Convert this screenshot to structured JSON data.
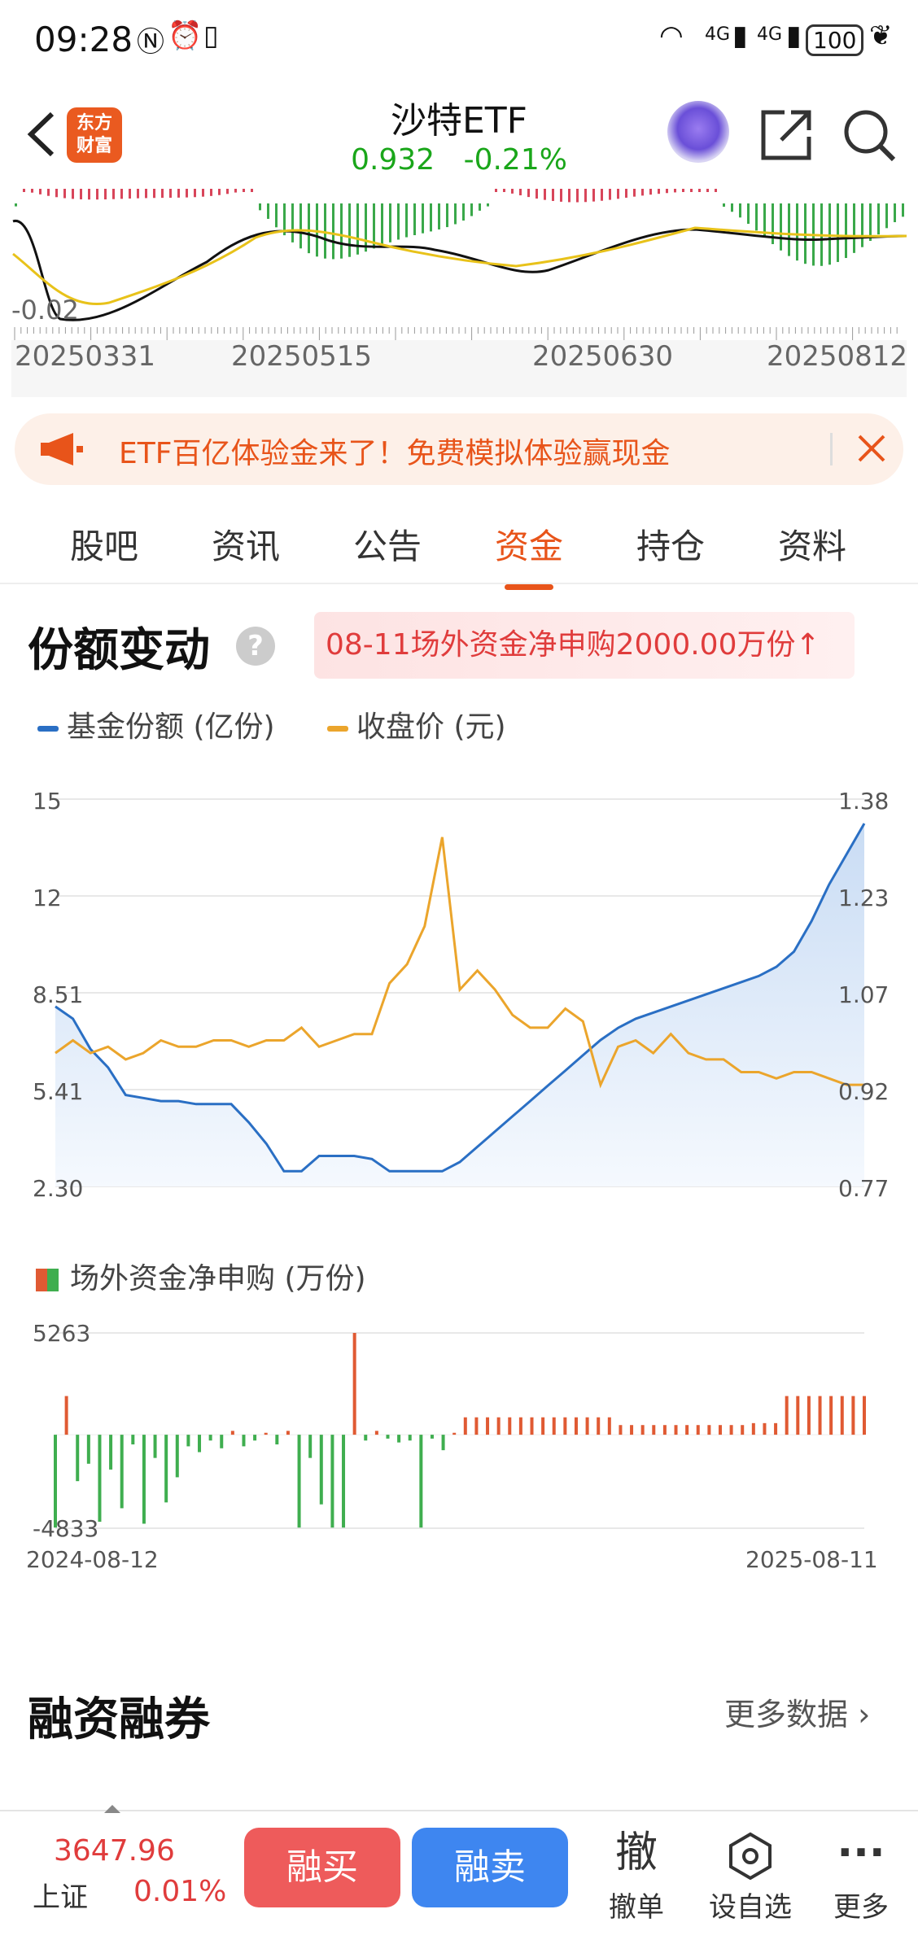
{
  "status_bar": {
    "time": "09:28",
    "battery": "100",
    "network": "4G"
  },
  "header": {
    "title": "沙特ETF",
    "price": "0.932",
    "change_pct": "-0.21%",
    "logo_text": "东方财富"
  },
  "kline": {
    "axis_label": "-0.02",
    "dates": [
      "20250331",
      "20250515",
      "20250630",
      "20250812"
    ]
  },
  "banner": {
    "text": "ETF百亿体验金来了！免费模拟体验赢现金"
  },
  "tabs": [
    {
      "label": "股吧"
    },
    {
      "label": "资讯"
    },
    {
      "label": "公告"
    },
    {
      "label": "资金",
      "active": true
    },
    {
      "label": "持仓"
    },
    {
      "label": "资料"
    }
  ],
  "share_section": {
    "title": "份额变动",
    "help": "?",
    "highlight": "08-11场外资金净申购2000.00万份",
    "highlight_arrow": "↑",
    "legend_shares": "基金份额 (亿份)",
    "legend_close": "收盘价 (元)",
    "color_shares": "#2a6fc4",
    "color_close": "#eba52c"
  },
  "chart_data": [
    {
      "type": "line",
      "left_axis_ticks": [
        "15",
        "12",
        "8.51",
        "5.41",
        "2.30"
      ],
      "right_axis_ticks": [
        "1.38",
        "1.23",
        "1.07",
        "0.92",
        "0.77"
      ],
      "ylim_left": [
        2.3,
        15
      ],
      "ylim_right": [
        0.77,
        1.38
      ],
      "x_start": "2024-08-12",
      "x_end": "2025-08-11",
      "series": [
        {
          "name": "基金份额 (亿份)",
          "axis": "left",
          "area": true,
          "values": [
            8.2,
            7.8,
            6.8,
            6.2,
            5.3,
            5.2,
            5.1,
            5.1,
            5.0,
            5.0,
            5.0,
            4.4,
            3.7,
            2.8,
            2.8,
            3.3,
            3.3,
            3.3,
            3.2,
            2.8,
            2.8,
            2.8,
            2.8,
            3.1,
            3.6,
            4.1,
            4.6,
            5.1,
            5.6,
            6.1,
            6.6,
            7.1,
            7.5,
            7.8,
            8.0,
            8.2,
            8.4,
            8.6,
            8.8,
            9.0,
            9.2,
            9.5,
            10.0,
            11.0,
            12.2,
            13.2,
            14.2
          ]
        },
        {
          "name": "收盘价 (元)",
          "axis": "right",
          "area": false,
          "values": [
            0.98,
            1.0,
            0.98,
            0.99,
            0.97,
            0.98,
            1.0,
            0.99,
            0.99,
            1.0,
            1.0,
            0.99,
            1.0,
            1.0,
            1.02,
            0.99,
            1.0,
            1.01,
            1.01,
            1.09,
            1.12,
            1.18,
            1.32,
            1.08,
            1.11,
            1.08,
            1.04,
            1.02,
            1.02,
            1.05,
            1.03,
            0.93,
            0.99,
            1.0,
            0.98,
            1.01,
            0.98,
            0.97,
            0.97,
            0.95,
            0.95,
            0.94,
            0.95,
            0.95,
            0.94,
            0.93,
            0.93
          ]
        }
      ]
    },
    {
      "type": "bar",
      "title": "场外资金净申购 (万份)",
      "ylim": [
        -4833,
        5263
      ],
      "y_ticks": [
        "5263",
        "-4833"
      ],
      "x_start": "2024-08-12",
      "x_end": "2025-08-11",
      "colors": {
        "positive": "#e05a33",
        "negative": "#3fae4f"
      },
      "values": [
        -4800,
        2000,
        -2400,
        -1500,
        -4500,
        -1800,
        -3800,
        -500,
        -4600,
        -1200,
        -3500,
        -2200,
        -600,
        -900,
        -300,
        -700,
        200,
        -600,
        -300,
        100,
        -500,
        200,
        -4800,
        -1200,
        -3600,
        -4800,
        -4800,
        5263,
        -300,
        200,
        -200,
        -400,
        -300,
        -4800,
        -200,
        -800,
        100,
        900,
        900,
        900,
        900,
        900,
        900,
        900,
        900,
        900,
        900,
        900,
        900,
        900,
        900,
        500,
        500,
        500,
        500,
        500,
        500,
        500,
        500,
        500,
        500,
        500,
        500,
        600,
        600,
        600,
        2000,
        2000,
        2000,
        2000,
        2000,
        2000,
        2000,
        2000
      ]
    }
  ],
  "margin_section": {
    "title": "融资融券",
    "more": "更多数据"
  },
  "bottom_bar": {
    "index_value": "3647.96",
    "index_name": "上证",
    "index_change": "0.01%",
    "buy": "融买",
    "sell": "融卖",
    "cancel_icon": "撤",
    "cancel": "撤单",
    "watch": "设自选",
    "more": "更多",
    "more_icon": "···"
  }
}
